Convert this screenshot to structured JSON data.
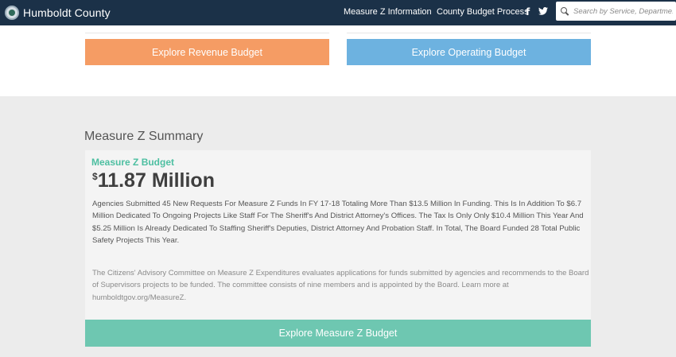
{
  "header": {
    "brand_name": "Humboldt County",
    "nav": {
      "measure_z_info": "Measure Z Information",
      "budget_process": "County Budget Process"
    },
    "social": {
      "facebook": "f",
      "twitter": "🐦"
    },
    "search": {
      "placeholder": "Search by Service, Departme."
    }
  },
  "top_buttons": {
    "revenue": "Explore Revenue Budget",
    "operating": "Explore Operating Budget"
  },
  "summary": {
    "section_title": "Measure Z Summary",
    "budget_label": "Measure Z Budget",
    "amount_currency": "$",
    "amount_value": "11.87 Million",
    "description": "Agencies Submitted 45 New Requests For Measure Z Funds In FY 17-18 Totaling More Than $13.5 Million In Funding. This Is In Addition To $6.7 Million Dedicated To Ongoing Projects Like Staff For The Sheriff's And District Attorney's Offices. The Tax Is Only Only $10.4 Million This Year And $5.25 Million Is Already Dedicated To Staffing Sheriff's Deputies, District Attorney And Probation Staff. In Total, The Board Funded 28 Total Public Safety Projects This Year.",
    "note": "The Citizens' Advisory Committee on Measure Z Expenditures evaluates applications for funds submitted by agencies and recommends to the Board of Supervisors projects to be funded. The committee consists of nine members and is appointed by the Board. Learn more at humboldtgov.org/MeasureZ.",
    "button": "Explore Measure Z Budget"
  },
  "colors": {
    "nav_bg": "#1b3148",
    "revenue_btn": "#f59c64",
    "operating_btn": "#6db2e0",
    "measurez_btn": "#6ec7b1",
    "accent_green": "#4dbfa1"
  }
}
